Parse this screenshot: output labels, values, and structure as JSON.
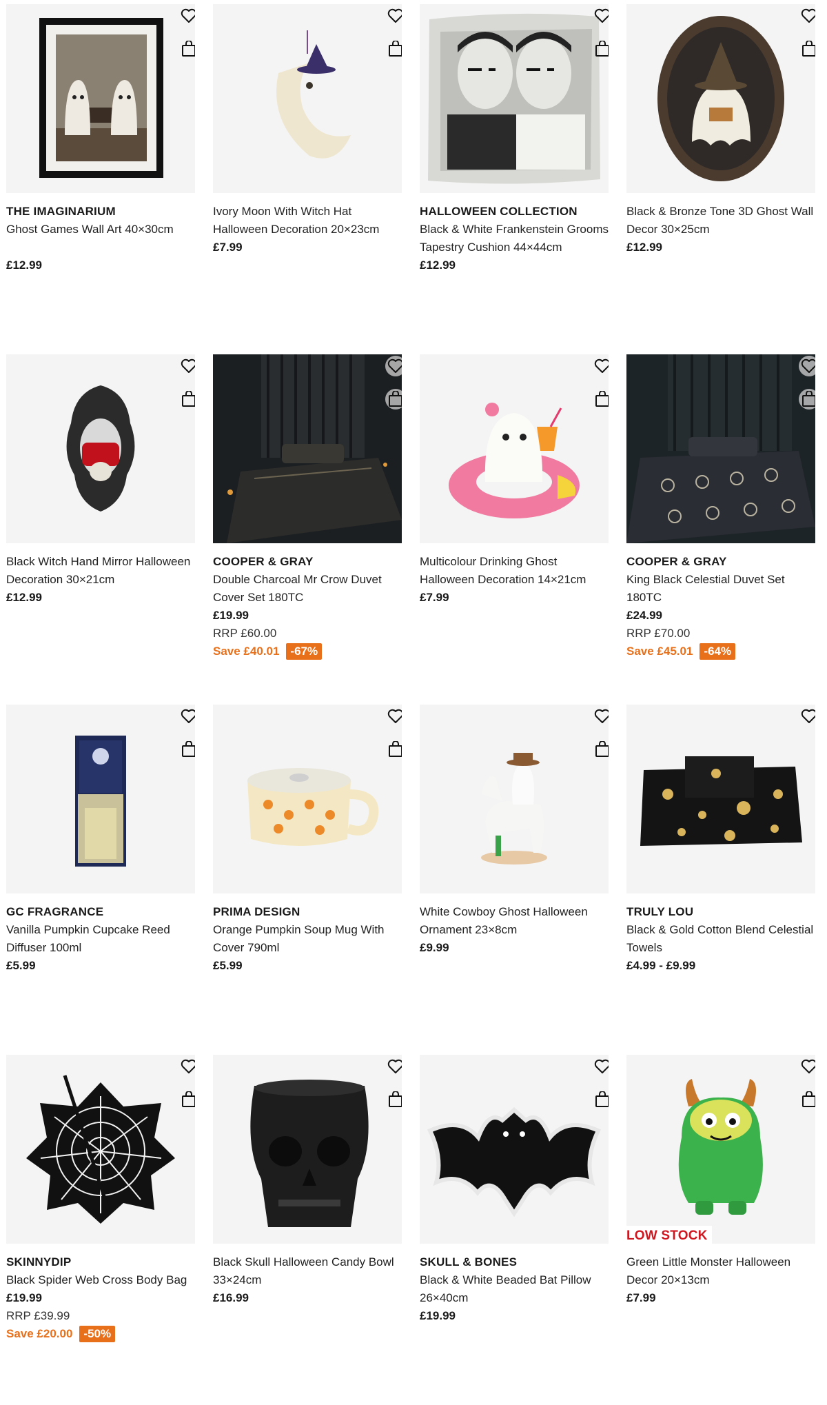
{
  "colors": {
    "accent_orange": "#e8701a",
    "low_stock_red": "#d0161f",
    "text": "#1a1a1a",
    "image_bg": "#f4f4f4"
  },
  "icons": {
    "wishlist": "heart-icon",
    "add_to_bag": "shopping-bag-icon"
  },
  "products": [
    {
      "brand": "THE IMAGINARIUM",
      "name": "Ghost Games Wall Art 40×30cm",
      "price": "£12.99"
    },
    {
      "brand": "",
      "name": "Ivory Moon With Witch Hat Halloween Decoration 20×23cm",
      "price": "£7.99"
    },
    {
      "brand": "HALLOWEEN COLLECTION",
      "name": "Black & White Frankenstein Grooms Tapestry Cushion 44×44cm",
      "price": "£12.99"
    },
    {
      "brand": "",
      "name": "Black & Bronze Tone 3D Ghost Wall Decor 30×25cm",
      "price": "£12.99"
    },
    {
      "brand": "",
      "name": "Black Witch Hand Mirror Halloween Decoration 30×21cm",
      "price": "£12.99"
    },
    {
      "brand": "COOPER & GRAY",
      "name": "Double Charcoal Mr Crow Duvet Cover Set 180TC",
      "price": "£19.99",
      "rrp": "RRP £60.00",
      "save": "Save £40.01",
      "pct": "-67%"
    },
    {
      "brand": "",
      "name": "Multicolour Drinking Ghost Halloween Decoration 14×21cm",
      "price": "£7.99"
    },
    {
      "brand": "COOPER & GRAY",
      "name": "King Black Celestial Duvet Set 180TC",
      "price": "£24.99",
      "rrp": "RRP £70.00",
      "save": "Save £45.01",
      "pct": "-64%"
    },
    {
      "brand": "GC FRAGRANCE",
      "name": "Vanilla Pumpkin Cupcake Reed Diffuser 100ml",
      "price": "£5.99"
    },
    {
      "brand": "PRIMA DESIGN",
      "name": "Orange Pumpkin Soup Mug With Cover 790ml",
      "price": "£5.99"
    },
    {
      "brand": "",
      "name": "White Cowboy Ghost Halloween Ornament 23×8cm",
      "price": "£9.99"
    },
    {
      "brand": "TRULY LOU",
      "name": "Black & Gold Cotton Blend Celestial Towels",
      "price": "£4.99 - £9.99"
    },
    {
      "brand": "SKINNYDIP",
      "name": "Black Spider Web Cross Body Bag",
      "price": "£19.99",
      "rrp": "RRP £39.99",
      "save": "Save £20.00",
      "pct": "-50%"
    },
    {
      "brand": "",
      "name": "Black Skull Halloween Candy Bowl 33×24cm",
      "price": "£16.99"
    },
    {
      "brand": "SKULL & BONES",
      "name": "Black & White Beaded Bat Pillow 26×40cm",
      "price": "£19.99"
    },
    {
      "brand": "",
      "name": "Green Little Monster Halloween Decor 20×13cm",
      "price": "£7.99",
      "badge": "LOW STOCK"
    }
  ]
}
